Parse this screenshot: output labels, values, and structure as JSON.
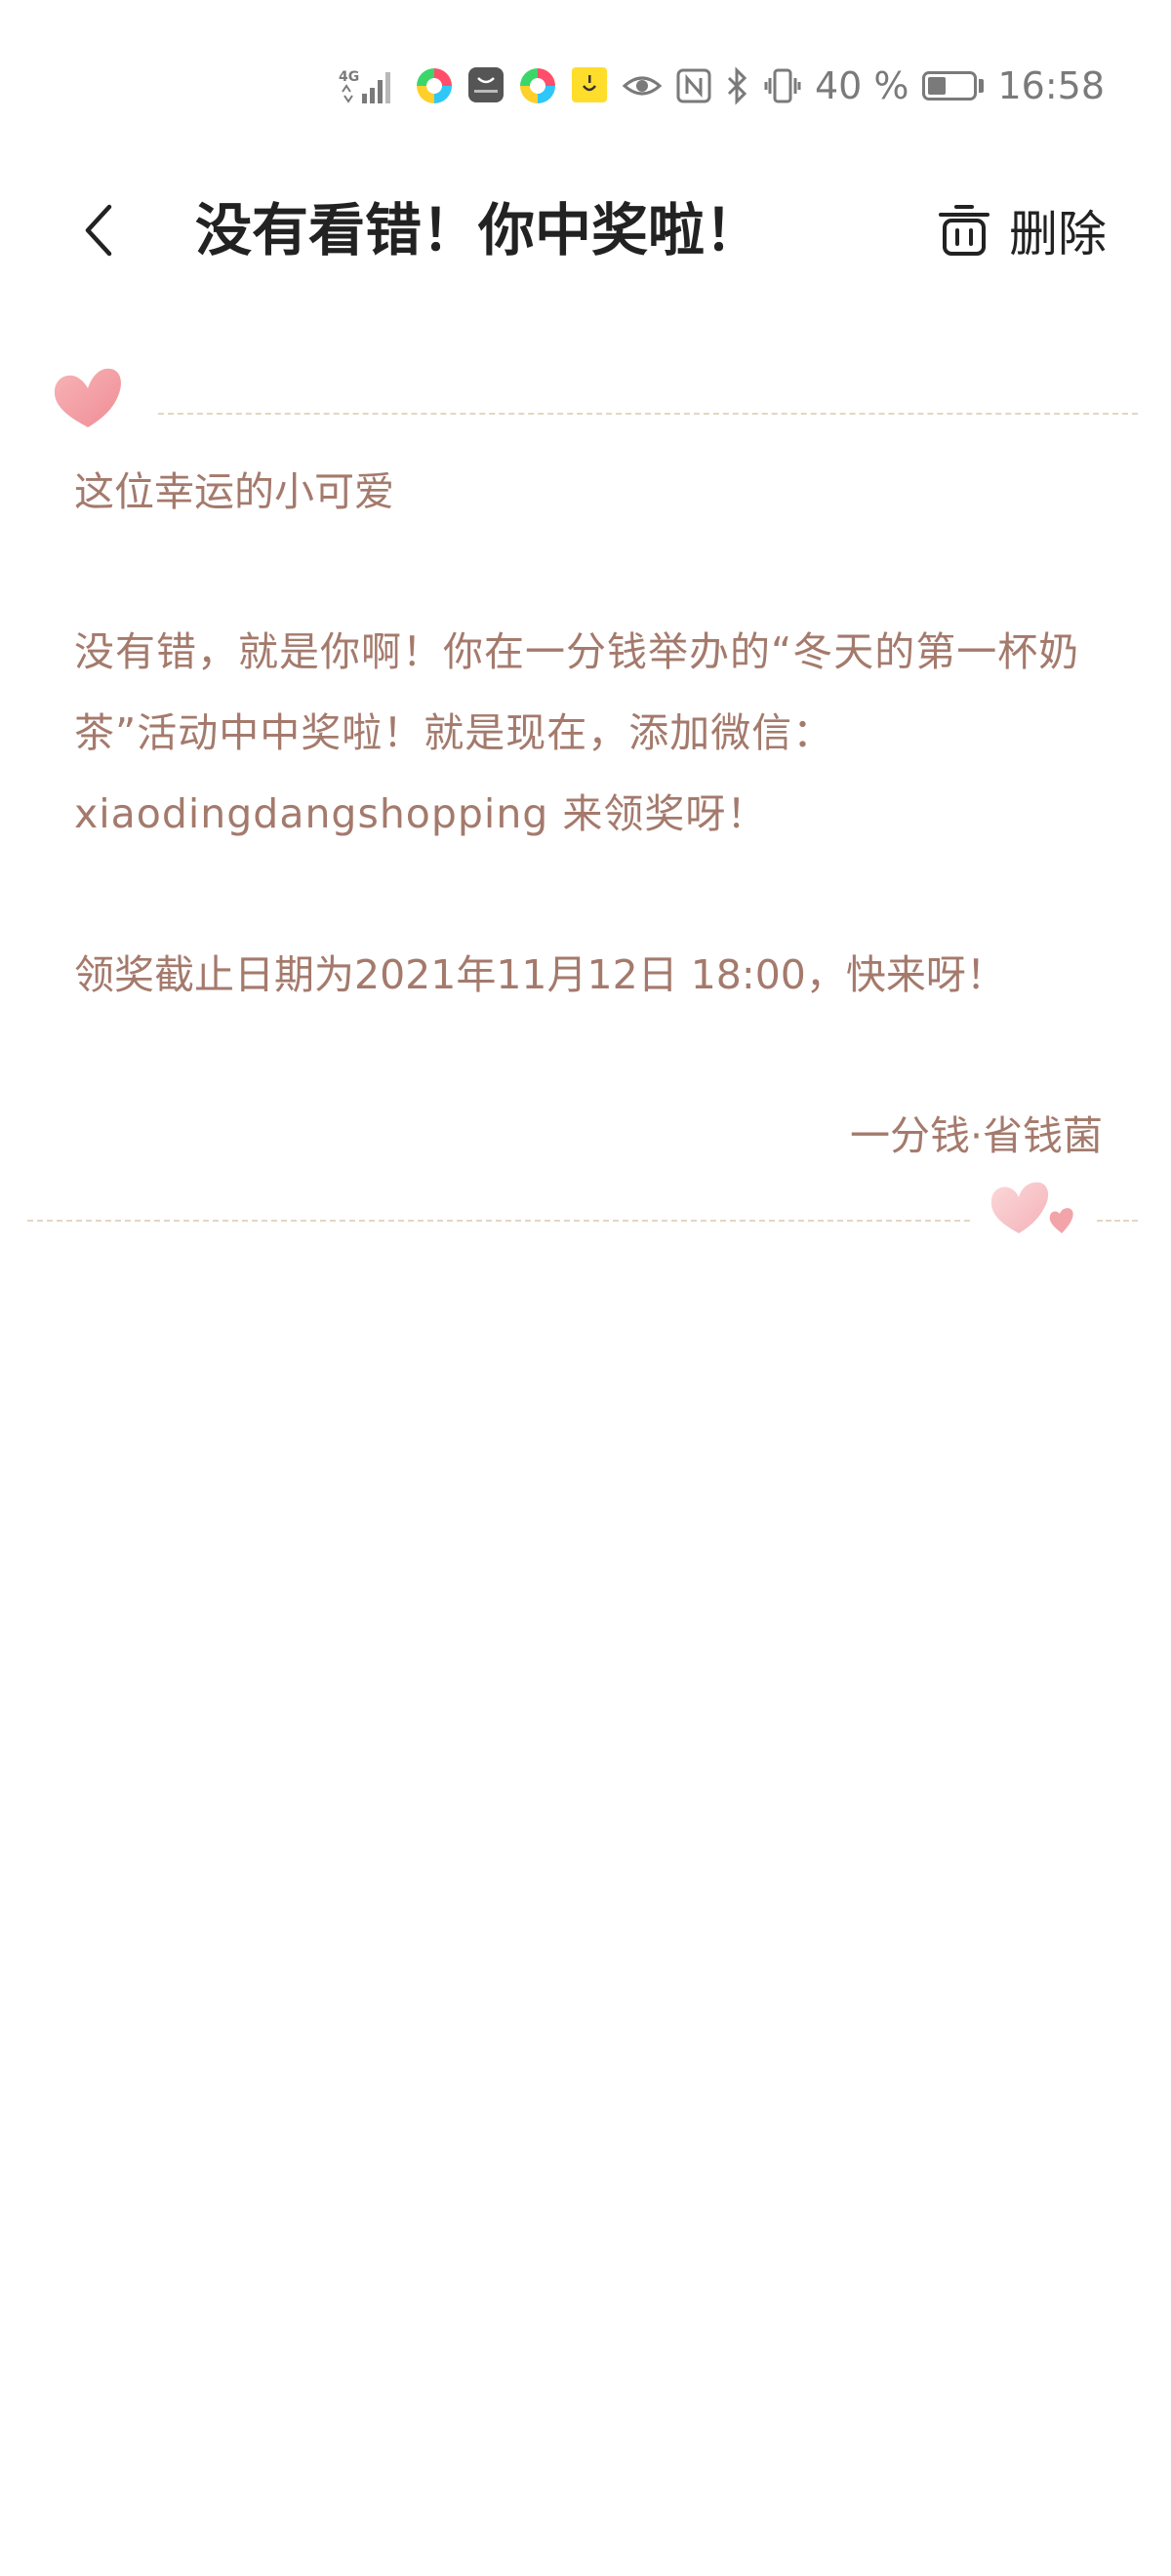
{
  "status_bar": {
    "network": "4G",
    "battery_text": "40 %",
    "battery_level": 0.4,
    "time": "16:58",
    "icons": [
      "signal-icon",
      "colorful-app-icon",
      "huawei-app-icon",
      "colorful-app-icon",
      "yellow-smile-app-icon",
      "eye-icon",
      "nfc-icon",
      "bluetooth-icon",
      "vibrate-icon",
      "battery-icon"
    ]
  },
  "header": {
    "title": "没有看错！你中奖啦！",
    "delete_label": "删除",
    "back_icon": "chevron-left-icon",
    "delete_icon": "trash-icon"
  },
  "letter": {
    "greeting": "这位幸运的小可爱",
    "body": "没有错，就是你啊！你在一分钱举办的“冬天的第一杯奶茶”活动中中奖啦！就是现在，添加微信：xiaodingdangshopping 来领奖呀！",
    "deadline": "领奖截止日期为2021年11月12日 18:00，快来呀！",
    "signature": "一分钱·省钱菌"
  },
  "colors": {
    "letter_text": "#a47a6c",
    "dash": "#e4d6c2",
    "heart": "#f2a4a8",
    "title_text": "#222222"
  }
}
